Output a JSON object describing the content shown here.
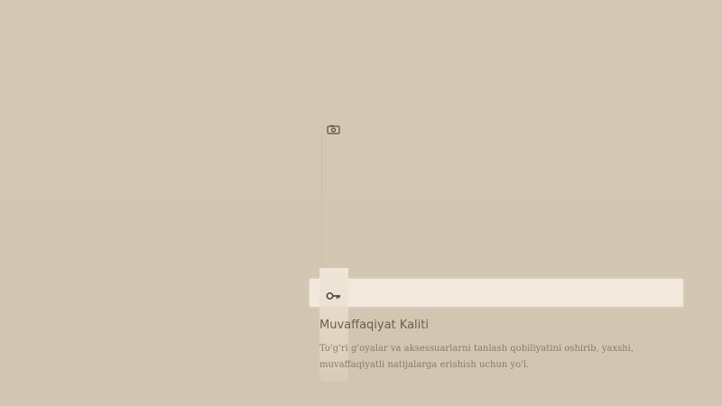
{
  "icons": {
    "top": "camera-icon",
    "key": "key-icon"
  },
  "achievement": {
    "title": "Muvaffaqiyat Kaliti",
    "description": "To'g'ri g'oyalar va aksessuarlarni tanlash qobiliyatini oshirib, yaxshi, muvaffaqiyatli natijalarga erishish uchun yo'l."
  },
  "colors": {
    "background": "#d3c7b4",
    "highlight": "#f2e9dc",
    "text": "#6a5e4d"
  }
}
